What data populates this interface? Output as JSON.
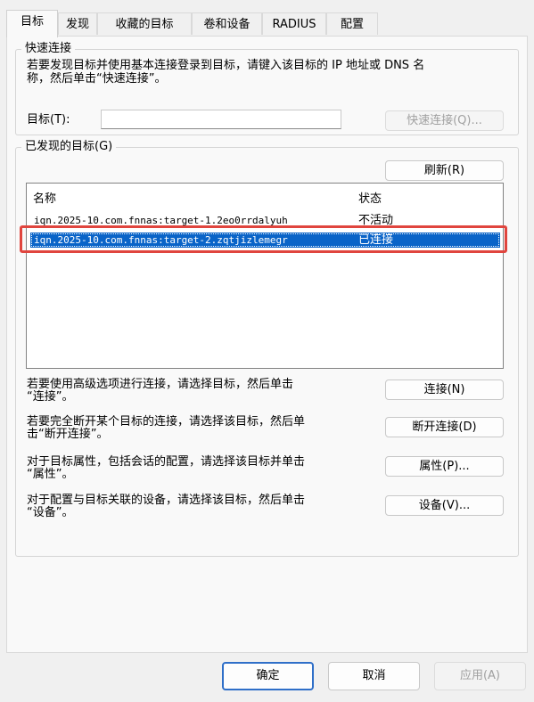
{
  "tabs": [
    {
      "label": "目标",
      "active": true
    },
    {
      "label": "发现",
      "active": false
    },
    {
      "label": "收藏的目标",
      "active": false
    },
    {
      "label": "卷和设备",
      "active": false
    },
    {
      "label": "RADIUS",
      "active": false
    },
    {
      "label": "配置",
      "active": false
    }
  ],
  "quick_connect": {
    "legend": "快速连接",
    "desc_line1": "若要发现目标并使用基本连接登录到目标，请键入该目标的 IP 地址或 DNS 名",
    "desc_line2": "称，然后单击“快速连接”。",
    "target_label": "目标(T):",
    "target_value": "",
    "button": "快速连接(Q)..."
  },
  "discovered": {
    "legend": "已发现的目标(G)",
    "refresh_button": "刷新(R)",
    "columns": [
      "名称",
      "状态"
    ],
    "rows": [
      {
        "name": "iqn.2025-10.com.fnnas:target-1.2eo0rrdalyuh",
        "status": "不活动",
        "selected": false
      },
      {
        "name": "iqn.2025-10.com.fnnas:target-2.zqtjizlemegr",
        "status": "已连接",
        "selected": true
      }
    ]
  },
  "actions": [
    {
      "line1": "若要使用高级选项进行连接，请选择目标，然后单击",
      "line2": "“连接”。",
      "button": "连接(N)"
    },
    {
      "line1": "若要完全断开某个目标的连接，请选择该目标，然后单",
      "line2": "击“断开连接”。",
      "button": "断开连接(D)"
    },
    {
      "line1": "对于目标属性，包括会话的配置，请选择该目标并单击",
      "line2": "“属性”。",
      "button": "属性(P)..."
    },
    {
      "line1": "对于配置与目标关联的设备，请选择该目标，然后单击",
      "line2": "“设备”。",
      "button": "设备(V)..."
    }
  ],
  "footer": {
    "ok": "确定",
    "cancel": "取消",
    "apply": "应用(A)"
  },
  "colors": {
    "selection": "#0a64c8",
    "highlight_box": "#e0453e",
    "default_button_border": "#2f6fc8"
  }
}
